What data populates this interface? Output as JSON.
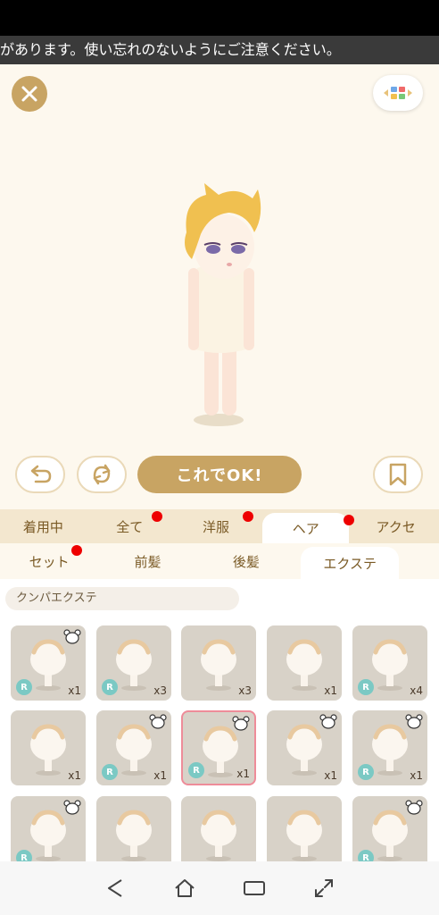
{
  "notice": {
    "ticker_text": "があります。使い忘れのないようにご注意ください。"
  },
  "actions": {
    "ok_label": "これでOK!"
  },
  "tabs": [
    {
      "label": "着用中",
      "dot": false
    },
    {
      "label": "全て",
      "dot": true
    },
    {
      "label": "洋服",
      "dot": true
    },
    {
      "label": "ヘア",
      "dot": true,
      "active": true
    },
    {
      "label": "アクセ",
      "dot": false
    }
  ],
  "subtabs": [
    {
      "label": "セット",
      "dot": true
    },
    {
      "label": "前髪",
      "dot": false
    },
    {
      "label": "後髪",
      "dot": false
    },
    {
      "label": "エクステ",
      "dot": false,
      "active": true
    }
  ],
  "category": {
    "label": "クンパエクステ"
  },
  "items": [
    {
      "count": "x1",
      "rarity": "R",
      "bear": true
    },
    {
      "count": "x3",
      "rarity": "R",
      "bear": false
    },
    {
      "count": "x3",
      "rarity": "",
      "bear": false
    },
    {
      "count": "x1",
      "rarity": "",
      "bear": false
    },
    {
      "count": "x4",
      "rarity": "R",
      "bear": false
    },
    {
      "count": "x1",
      "rarity": "",
      "bear": false
    },
    {
      "count": "x1",
      "rarity": "R",
      "bear": true
    },
    {
      "count": "x1",
      "rarity": "R",
      "bear": true,
      "selected": true
    },
    {
      "count": "x1",
      "rarity": "",
      "bear": true
    },
    {
      "count": "x1",
      "rarity": "R",
      "bear": true
    },
    {
      "count": "",
      "rarity": "R",
      "bear": true
    },
    {
      "count": "",
      "rarity": "",
      "bear": false
    },
    {
      "count": "",
      "rarity": "",
      "bear": false
    },
    {
      "count": "",
      "rarity": "",
      "bear": false
    },
    {
      "count": "",
      "rarity": "R",
      "bear": true
    }
  ],
  "colors": {
    "gold": "#c8a463",
    "tab_bg": "#f3e7cf",
    "dot": "#ee0000",
    "rarity": "#7bc9c4",
    "selected_border": "#ee8c99"
  },
  "icons": {
    "close": "close-icon",
    "view": "color-grid-icon",
    "undo": "undo-icon",
    "rotate": "rotate-icon",
    "bookmark": "bookmark-icon",
    "nav_back": "triangle-back-icon",
    "nav_home": "home-icon",
    "nav_recent": "recent-apps-icon",
    "nav_rotate": "screen-rotate-icon"
  }
}
